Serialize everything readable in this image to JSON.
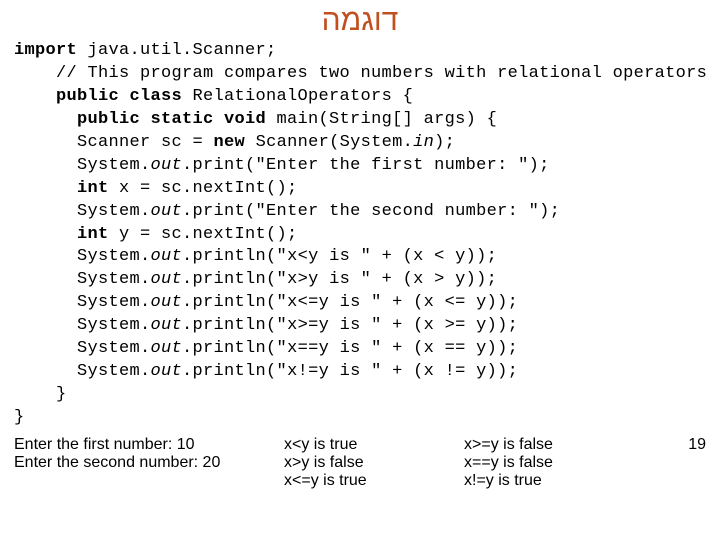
{
  "title": "דוגמה",
  "code": {
    "l1a": "import",
    "l1b": " java.util.Scanner;",
    "l2": "    // This program compares two numbers with relational operators",
    "l3a": "    public class",
    "l3b": " RelationalOperators {",
    "l4a": "      public static void",
    "l4b": " main(String[] args) {",
    "l5a": "      Scanner sc = ",
    "l5b": "new",
    "l5c": " Scanner(System.",
    "l5d": "in",
    "l5e": ");",
    "l6a": "      System.",
    "l6b": "out",
    "l6c": ".print(\"Enter the first number: \");",
    "l7a": "      int",
    "l7b": " x = sc.nextInt();",
    "l8a": "      System.",
    "l8b": "out",
    "l8c": ".print(\"Enter the second number: \");",
    "l9a": "      int",
    "l9b": " y = sc.nextInt();",
    "l10a": "      System.",
    "l10b": "out",
    "l10c": ".println(\"x<y is \" + (x < y));",
    "l11a": "      System.",
    "l11b": "out",
    "l11c": ".println(\"x>y is \" + (x > y));",
    "l12a": "      System.",
    "l12b": "out",
    "l12c": ".println(\"x<=y is \" + (x <= y));",
    "l13a": "      System.",
    "l13b": "out",
    "l13c": ".println(\"x>=y is \" + (x >= y));",
    "l14a": "      System.",
    "l14b": "out",
    "l14c": ".println(\"x==y is \" + (x == y));",
    "l15a": "      System.",
    "l15b": "out",
    "l15c": ".println(\"x!=y is \" + (x != y));",
    "l16": "    }",
    "l17": "}"
  },
  "output": {
    "col1": {
      "a": "Enter the first number: 10",
      "b": "Enter the second number: 20"
    },
    "col2": {
      "a": "x<y is true",
      "b": "x>y is false",
      "c": "x<=y is true"
    },
    "col3": {
      "a": "x>=y is false",
      "b": "x==y is false",
      "c": "x!=y is true"
    }
  },
  "page": "19"
}
